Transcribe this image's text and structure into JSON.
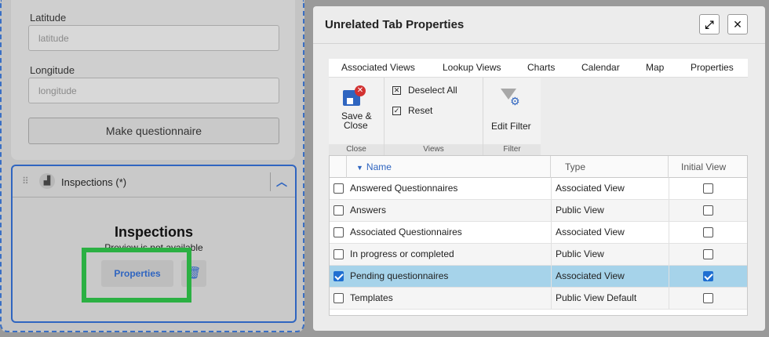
{
  "left_panel": {
    "latitude_label": "Latitude",
    "latitude_placeholder": "latitude",
    "longitude_label": "Longitude",
    "longitude_placeholder": "longitude",
    "make_questionnaire": "Make questionnaire"
  },
  "inspections_card": {
    "header_title": "Inspections (*)",
    "big_title": "Inspections",
    "subtitle": "Preview is not available",
    "properties_button": "Properties"
  },
  "dialog": {
    "title": "Unrelated Tab Properties",
    "tabs": [
      {
        "label": "Associated Views"
      },
      {
        "label": "Lookup Views"
      },
      {
        "label": "Charts"
      },
      {
        "label": "Calendar"
      },
      {
        "label": "Map"
      },
      {
        "label": "Properties"
      }
    ],
    "ribbon": {
      "save_close": "Save &",
      "save_close_2": "Close",
      "close_group": "Close",
      "deselect_all": "Deselect All",
      "reset": "Reset",
      "views_group": "Views",
      "edit_filter": "Edit Filter",
      "filter_group": "Filter"
    },
    "table": {
      "columns": [
        "Name",
        "Type",
        "Initial View"
      ],
      "rows": [
        {
          "name": "Answered Questionnaires",
          "type": "Associated View",
          "selected": false,
          "initial": false
        },
        {
          "name": "Answers",
          "type": "Public View",
          "selected": false,
          "initial": false
        },
        {
          "name": "Associated Questionnaires",
          "type": "Associated View",
          "selected": false,
          "initial": false
        },
        {
          "name": "In progress or completed",
          "type": "Public View",
          "selected": false,
          "initial": false
        },
        {
          "name": "Pending questionnaires",
          "type": "Associated View",
          "selected": true,
          "initial": true
        },
        {
          "name": "Templates",
          "type": "Public View Default",
          "selected": false,
          "initial": false
        }
      ]
    }
  },
  "colors": {
    "accent": "#2f65c0",
    "highlight": "#2bb043",
    "selected_row": "#a6d3ea"
  }
}
